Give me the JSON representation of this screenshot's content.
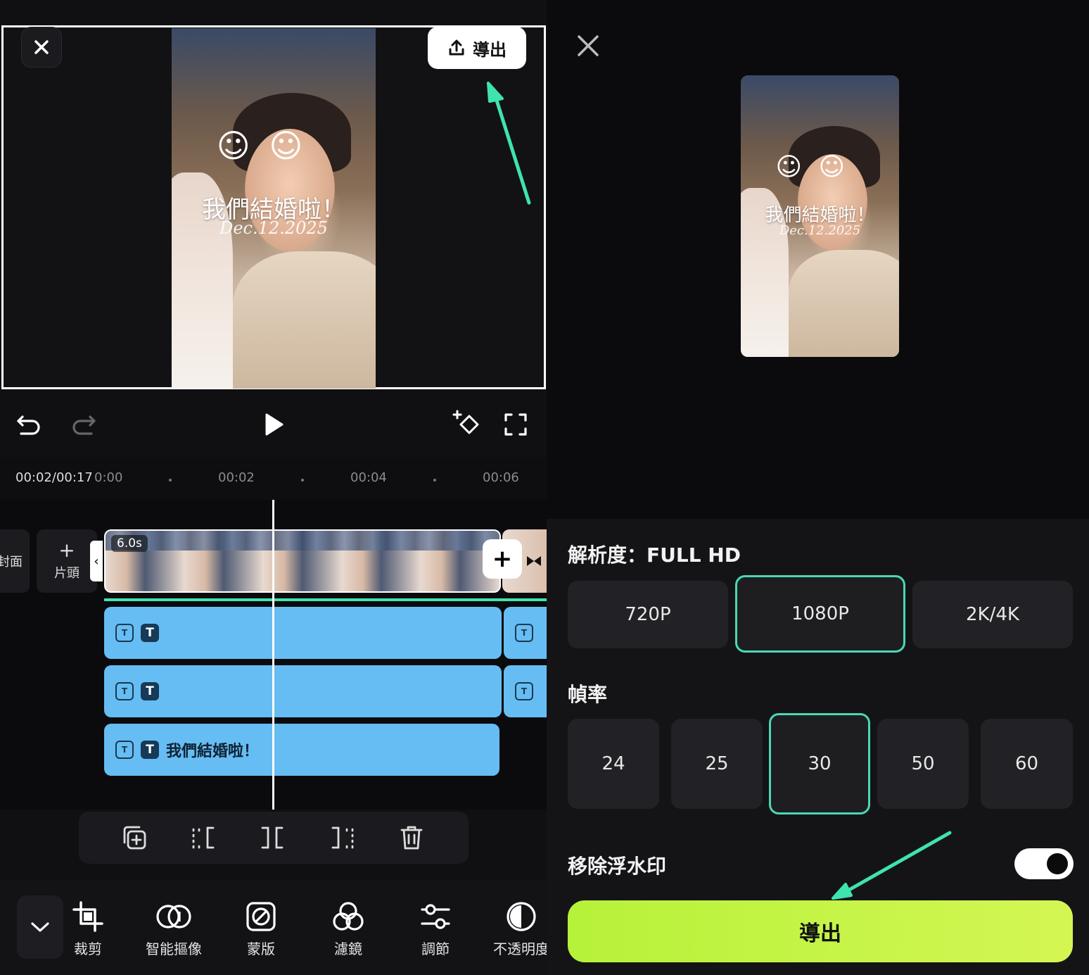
{
  "editor": {
    "export_button_label": "導出",
    "preview_title": "我們結婚啦！",
    "preview_date": "Dec.12.2025",
    "doodle_text": "☺ ☺",
    "time_current": "00:02/00:17",
    "ruler_ticks": [
      "0:00",
      "00:02",
      "00:04",
      "00:06"
    ],
    "clip_duration": "6.0s",
    "cover_label": "封面",
    "head_label": "片頭",
    "head_plus": "+",
    "add_symbol": "+",
    "text_track_3_label": "我們結婚啦！",
    "tools": [
      {
        "label": "裁剪",
        "icon": "crop-icon"
      },
      {
        "label": "智能摳像",
        "icon": "smart-cutout-icon"
      },
      {
        "label": "蒙版",
        "icon": "mask-icon"
      },
      {
        "label": "濾鏡",
        "icon": "filter-icon"
      },
      {
        "label": "調節",
        "icon": "adjust-icon"
      },
      {
        "label": "不透明度",
        "icon": "opacity-icon"
      }
    ]
  },
  "export_panel": {
    "resolution_title": "解析度：FULL HD",
    "resolution_options": [
      "720P",
      "1080P",
      "2K/4K"
    ],
    "resolution_selected": "1080P",
    "framerate_title": "幀率",
    "framerate_options": [
      "24",
      "25",
      "30",
      "50",
      "60"
    ],
    "framerate_selected": "30",
    "watermark_label": "移除浮水印",
    "watermark_toggle_on": true,
    "export_label": "導出"
  },
  "colors": {
    "accent_teal": "#4ad8b4",
    "export_green": "#c6f34a",
    "text_track_blue": "#66bdf3"
  }
}
